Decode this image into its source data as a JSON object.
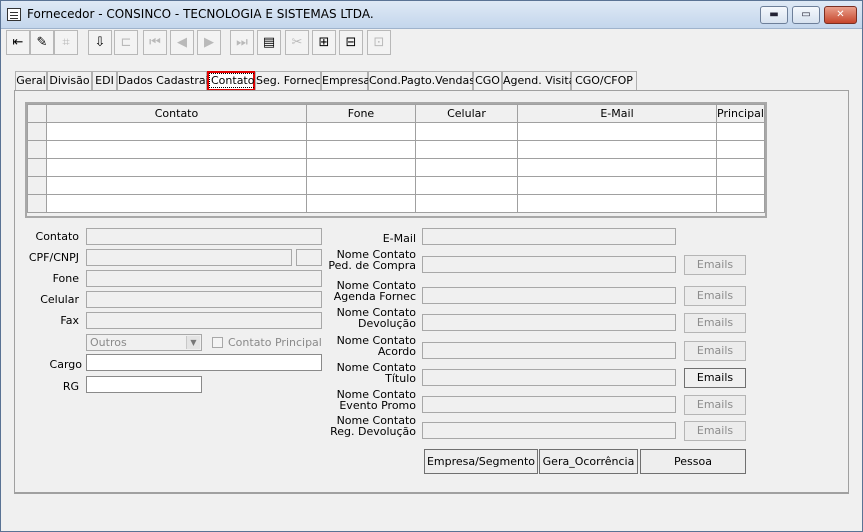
{
  "window": {
    "title": "Fornecedor - CONSINCO - TECNOLOGIA E SISTEMAS LTDA.",
    "min_label": "▬",
    "max_label": "▭",
    "close_label": "✕"
  },
  "toolbar": {
    "buttons": [
      {
        "icon": "exit-icon",
        "glyph": "⇤",
        "enabled": true
      },
      {
        "icon": "eraser-icon",
        "glyph": "✎",
        "enabled": true
      },
      {
        "icon": "tree-icon",
        "glyph": "⌗",
        "enabled": false
      },
      {
        "icon": "download-icon",
        "glyph": "⇩",
        "enabled": true
      },
      {
        "icon": "branch-icon",
        "glyph": "⊏",
        "enabled": false
      },
      {
        "icon": "first-icon",
        "glyph": "⏮",
        "enabled": false
      },
      {
        "icon": "prev-icon",
        "glyph": "◀",
        "enabled": false
      },
      {
        "icon": "next-icon",
        "glyph": "▶",
        "enabled": false
      },
      {
        "icon": "last-icon",
        "glyph": "⏭",
        "enabled": false
      },
      {
        "icon": "film-icon",
        "glyph": "▤",
        "enabled": true
      },
      {
        "icon": "scissors-icon",
        "glyph": "✂",
        "enabled": false
      },
      {
        "icon": "add-record-icon",
        "glyph": "⊞",
        "enabled": true
      },
      {
        "icon": "delete-record-icon",
        "glyph": "⊟",
        "enabled": true
      },
      {
        "icon": "table-icon",
        "glyph": "⊡",
        "enabled": false
      }
    ]
  },
  "tabs": [
    {
      "label": "Geral"
    },
    {
      "label": "Divisão"
    },
    {
      "label": "EDI"
    },
    {
      "label": "Dados Cadastrais"
    },
    {
      "label": "Contato",
      "active": true
    },
    {
      "label": "Seg. Fornec"
    },
    {
      "label": "Empresa"
    },
    {
      "label": "Cond.Pagto.Vendas"
    },
    {
      "label": "CGO"
    },
    {
      "label": "Agend. Visita"
    },
    {
      "label": "CGO/CFOP"
    }
  ],
  "grid": {
    "columns": [
      "Contato",
      "Fone",
      "Celular",
      "E-Mail",
      "Principal"
    ],
    "rows": 5
  },
  "left_form": {
    "contato": "Contato",
    "cpf_cnpj": "CPF/CNPJ",
    "fone": "Fone",
    "celular": "Celular",
    "fax": "Fax",
    "tipo_value": "Outros",
    "contato_principal": "Contato Principal",
    "cargo": "Cargo",
    "rg": "RG"
  },
  "right_form": {
    "email": "E-Mail",
    "fields": [
      {
        "line1": "Nome Contato",
        "line2": "Ped. de Compra",
        "button": "Emails",
        "enabled": false
      },
      {
        "line1": "Nome Contato",
        "line2": "Agenda Fornec",
        "button": "Emails",
        "enabled": false
      },
      {
        "line1": "Nome Contato",
        "line2": "Devolução",
        "button": "Emails",
        "enabled": false
      },
      {
        "line1": "Nome Contato",
        "line2": "Acordo",
        "button": "Emails",
        "enabled": false
      },
      {
        "line1": "Nome Contato",
        "line2": "Título",
        "button": "Emails",
        "enabled": true
      },
      {
        "line1": "Nome Contato",
        "line2": "Evento Promo",
        "button": "Emails",
        "enabled": false
      },
      {
        "line1": "Nome Contato",
        "line2": "Reg. Devolução",
        "button": "Emails",
        "enabled": false
      }
    ]
  },
  "actions": {
    "empresa_segmento": "Empresa/Segmento",
    "gera_ocorrencia": "Gera_Ocorrência",
    "pessoa": "Pessoa"
  }
}
